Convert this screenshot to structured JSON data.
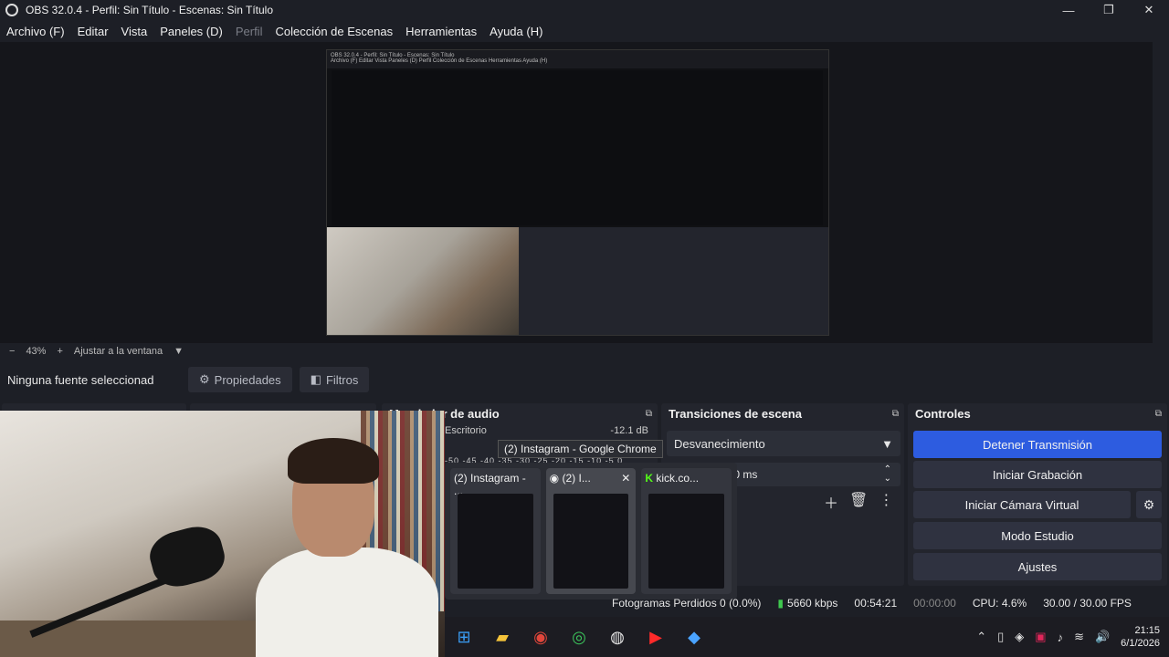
{
  "window": {
    "title": "OBS 32.0.4 - Perfil: Sin Título - Escenas: Sin Título",
    "minimize": "—",
    "maximize": "❐",
    "close": "✕"
  },
  "menu": [
    "Archivo (F)",
    "Editar",
    "Vista",
    "Paneles (D)",
    "Perfil",
    "Colección de Escenas",
    "Herramientas",
    "Ayuda (H)"
  ],
  "scale": {
    "minus": "−",
    "zoom": "43%",
    "plus": "+",
    "fit": "Ajustar a la ventana",
    "dropdown": "▼"
  },
  "source_bar": {
    "no_source": "Ninguna fuente seleccionad",
    "properties": "Propiedades",
    "filters": "Filtros"
  },
  "docks": {
    "audio_title": "Mezclador de audio",
    "audio_source": "Escritorio",
    "audio_level": "-12.1 dB",
    "audio_scale": "-50 -45 -40 -35 -30 -25 -20 -15 -10 -5 0",
    "transitions_title": "Transiciones de escena",
    "transition_type": "Desvanecimiento",
    "duration": "300 ms",
    "controls_title": "Controles"
  },
  "controls": {
    "stop_stream": "Detener Transmisión",
    "start_rec": "Iniciar Grabación",
    "virtual_cam": "Iniciar Cámara Virtual",
    "studio": "Modo Estudio",
    "settings": "Ajustes"
  },
  "taskbar_preview": {
    "tooltip": "(2) Instagram - Google Chrome",
    "cards": [
      "(2) Instagram - ...",
      "(2) I...",
      "kick.co..."
    ]
  },
  "status": {
    "dropped": "Fotogramas Perdidos 0 (0.0%)",
    "bitrate": "5660 kbps",
    "stream_time": "00:54:21",
    "rec_time": "00:00:00",
    "cpu": "CPU: 4.6%",
    "fps": "30.00 / 30.00 FPS"
  },
  "clock": {
    "time": "21:15",
    "date": "6/1/2026"
  },
  "nested": {
    "title": "OBS 32.0.4 - Perfil: Sin Título - Escenas: Sin Título",
    "menu": "Archivo (F)   Editar   Vista   Paneles (D)   Perfil   Colección de Escenas   Herramientas   Ayuda (H)"
  }
}
